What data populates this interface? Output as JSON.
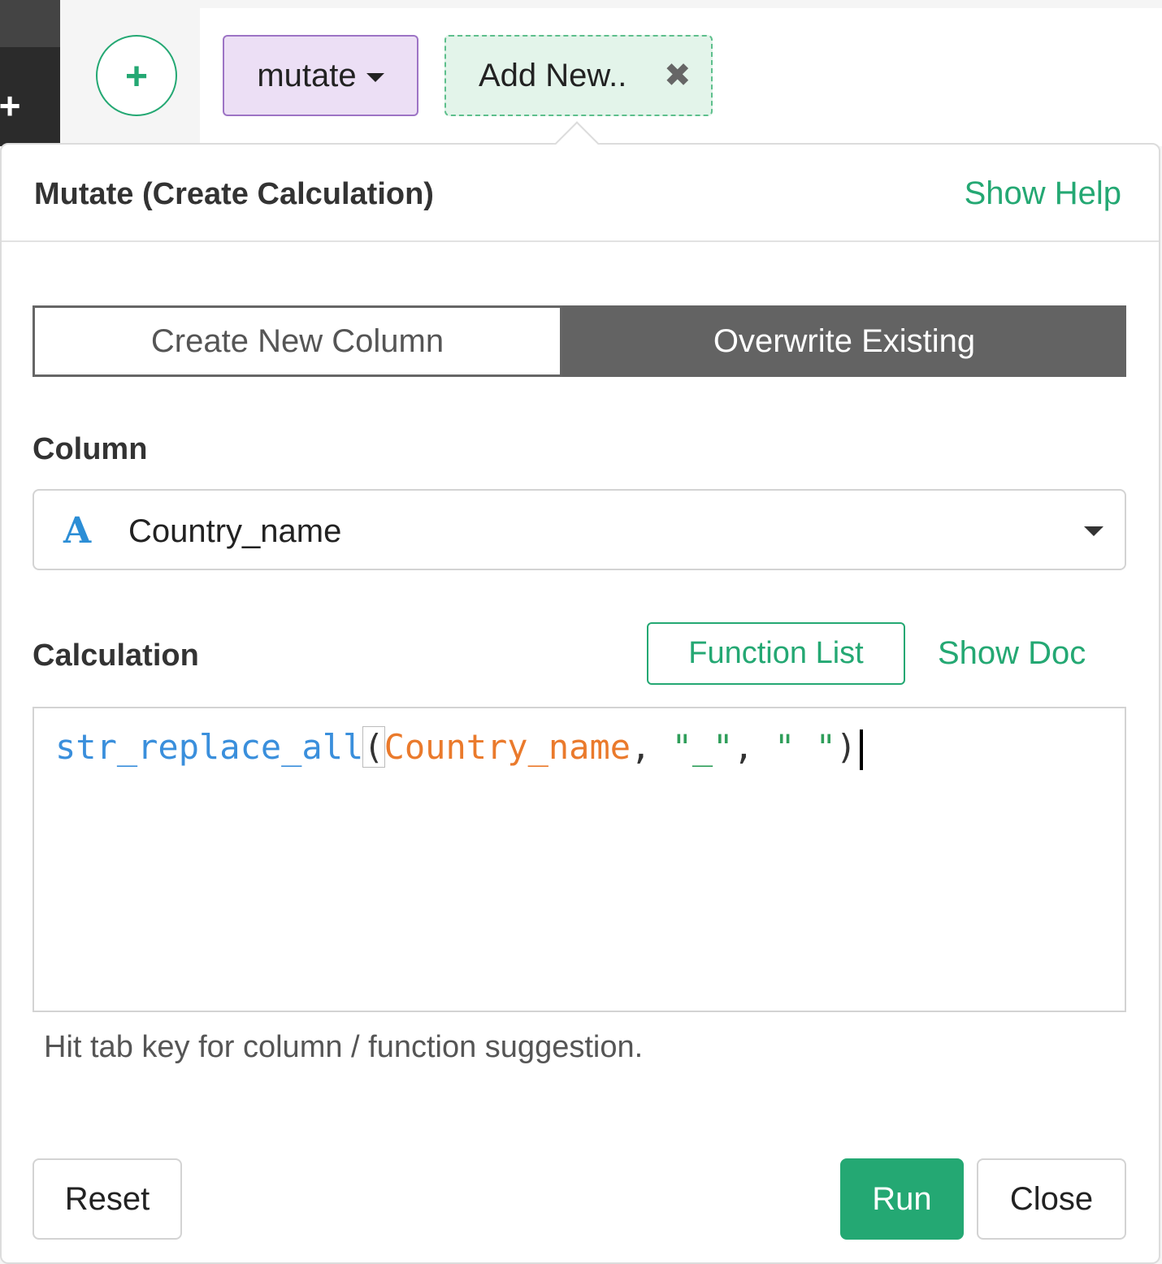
{
  "toolbar": {
    "add_step_symbol": "+",
    "steps": [
      {
        "label": "mutate",
        "has_dropdown": true,
        "color": "#ecdff5"
      },
      {
        "label": "Add New..",
        "close_symbol": "✖",
        "color": "#e3f4ea"
      }
    ]
  },
  "panel": {
    "title": "Mutate (Create Calculation)",
    "show_help": "Show Help",
    "mode_options": [
      "Create New Column",
      "Overwrite Existing"
    ],
    "selected_mode": "Overwrite Existing",
    "column": {
      "label": "Column",
      "type_icon": "A",
      "value": "Country_name"
    },
    "calculation": {
      "label": "Calculation",
      "function_list": "Function List",
      "show_doc": "Show Doc",
      "code": {
        "fn": "str_replace_all",
        "open": "(",
        "col": "Country_name",
        "sep1": ", ",
        "arg1": "\"_\"",
        "sep2": ", ",
        "arg2": "\" \"",
        "close": ")"
      }
    },
    "hint": "Hit tab key for column / function suggestion.",
    "buttons": {
      "reset": "Reset",
      "run": "Run",
      "close": "Close"
    }
  },
  "colors": {
    "accent": "#24a873",
    "function_token": "#3a8fdc",
    "column_token": "#ea7a2c",
    "string_token": "#2f9e5a"
  }
}
